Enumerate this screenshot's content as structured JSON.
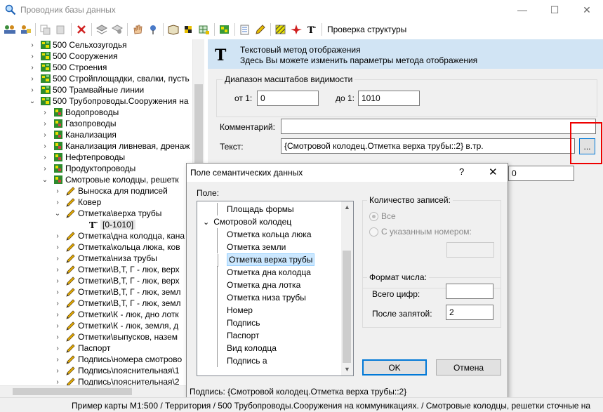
{
  "window": {
    "title": "Проводник базы данных",
    "minimize": "—",
    "maximize": "☐",
    "close": "✕"
  },
  "toolbar": {
    "check_structure": "Проверка структуры"
  },
  "tree": {
    "items": [
      {
        "label": "500 Сельхозугодья",
        "level": 0,
        "chev": "›",
        "icon": "map-layer-icon"
      },
      {
        "label": "500 Сооружения",
        "level": 0,
        "chev": "›",
        "icon": "map-layer-icon"
      },
      {
        "label": "500 Строения",
        "level": 0,
        "chev": "›",
        "icon": "map-layer-icon"
      },
      {
        "label": "500 Стройплощадки, свалки, пусть",
        "level": 0,
        "chev": "›",
        "icon": "map-layer-icon"
      },
      {
        "label": "500 Трамвайные линии",
        "level": 0,
        "chev": "›",
        "icon": "map-layer-icon"
      },
      {
        "label": "500 Трубопроводы.Сооружения на",
        "level": 0,
        "chev": "⌄",
        "icon": "map-layer-icon"
      },
      {
        "label": "Водопроводы",
        "level": 1,
        "chev": "›",
        "icon": "object-icon"
      },
      {
        "label": "Газопроводы",
        "level": 1,
        "chev": "›",
        "icon": "object-icon"
      },
      {
        "label": "Канализация",
        "level": 1,
        "chev": "›",
        "icon": "object-icon"
      },
      {
        "label": "Канализация ливневая, дренаж",
        "level": 1,
        "chev": "›",
        "icon": "object-icon"
      },
      {
        "label": "Нефтепроводы",
        "level": 1,
        "chev": "›",
        "icon": "object-icon"
      },
      {
        "label": "Продуктопроводы",
        "level": 1,
        "chev": "›",
        "icon": "object-icon"
      },
      {
        "label": "Смотровые колодцы, решетк",
        "level": 1,
        "chev": "⌄",
        "icon": "object-icon"
      },
      {
        "label": "Выноска для подписей",
        "level": 2,
        "chev": "›",
        "icon": "pencil-icon"
      },
      {
        "label": "Ковер",
        "level": 2,
        "chev": "›",
        "icon": "pencil-icon"
      },
      {
        "label": "Отметка\\верха трубы",
        "level": 2,
        "chev": "⌄",
        "icon": "pencil-icon"
      },
      {
        "label": "[0-1010]",
        "level": 3,
        "chev": "",
        "icon": "text-method-icon"
      },
      {
        "label": "Отметка\\дна колодца, кана",
        "level": 2,
        "chev": "›",
        "icon": "pencil-icon"
      },
      {
        "label": "Отметка\\кольца люка, ков",
        "level": 2,
        "chev": "›",
        "icon": "pencil-icon"
      },
      {
        "label": "Отметка\\низа трубы",
        "level": 2,
        "chev": "›",
        "icon": "pencil-icon"
      },
      {
        "label": "Отметки\\В,Т, Г - люк, верх",
        "level": 2,
        "chev": "›",
        "icon": "pencil-icon"
      },
      {
        "label": "Отметки\\В,Т, Г - люк, верх",
        "level": 2,
        "chev": "›",
        "icon": "pencil-icon"
      },
      {
        "label": "Отметки\\В,Т, Г - люк, земл",
        "level": 2,
        "chev": "›",
        "icon": "pencil-icon"
      },
      {
        "label": "Отметки\\В,Т, Г - люк, земл",
        "level": 2,
        "chev": "›",
        "icon": "pencil-icon"
      },
      {
        "label": "Отметки\\К - люк, дно лотк",
        "level": 2,
        "chev": "›",
        "icon": "pencil-icon"
      },
      {
        "label": "Отметки\\К - люк, земля, д",
        "level": 2,
        "chev": "›",
        "icon": "pencil-icon"
      },
      {
        "label": "Отметки\\выпусков, назем",
        "level": 2,
        "chev": "›",
        "icon": "pencil-icon"
      },
      {
        "label": "Паспорт",
        "level": 2,
        "chev": "›",
        "icon": "pencil-icon"
      },
      {
        "label": "Подпись\\номера смотрово",
        "level": 2,
        "chev": "›",
        "icon": "pencil-icon"
      },
      {
        "label": "Подпись\\пояснительная\\1",
        "level": 2,
        "chev": "›",
        "icon": "pencil-icon"
      },
      {
        "label": "Подпись\\пояснительная\\2",
        "level": 2,
        "chev": "›",
        "icon": "pencil-icon"
      }
    ]
  },
  "panel": {
    "header_title": "Текстовый метод отображения",
    "header_subtitle": "Здесь Вы можете изменить параметры метода отображения",
    "scale_group": "Диапазон масштабов видимости",
    "from_label": "от 1:",
    "from_value": "0",
    "to_label": "до 1:",
    "to_value": "1010",
    "comment_label": "Комментарий:",
    "comment_value": "",
    "text_label": "Текст:",
    "text_value": "{Смотровой колодец.Отметка верха трубы::2} в.тр.",
    "browse_label": "...",
    "partial_value": "0"
  },
  "dialog": {
    "title": "Поле семантических данных",
    "help": "?",
    "close": "✕",
    "field_label": "Поле:",
    "list_items": [
      {
        "label": "Площадь формы",
        "indent": 1,
        "toggle": ""
      },
      {
        "label": "Смотровой колодец",
        "indent": 0,
        "toggle": "⌄"
      },
      {
        "label": "Отметка кольца люка",
        "indent": 1,
        "toggle": ""
      },
      {
        "label": "Отметка земли",
        "indent": 1,
        "toggle": ""
      },
      {
        "label": "Отметка верха трубы",
        "indent": 1,
        "toggle": "",
        "selected": true
      },
      {
        "label": "Отметка дна колодца",
        "indent": 1,
        "toggle": ""
      },
      {
        "label": "Отметка дна лотка",
        "indent": 1,
        "toggle": ""
      },
      {
        "label": "Отметка низа трубы",
        "indent": 1,
        "toggle": ""
      },
      {
        "label": "Номер",
        "indent": 1,
        "toggle": ""
      },
      {
        "label": "Подпись",
        "indent": 1,
        "toggle": ""
      },
      {
        "label": "Паспорт",
        "indent": 1,
        "toggle": ""
      },
      {
        "label": "Вид колодца",
        "indent": 1,
        "toggle": ""
      },
      {
        "label": "Подпись а",
        "indent": 1,
        "toggle": ""
      }
    ],
    "records_group": "Количество записей:",
    "radio_all": "Все",
    "radio_number": "С указанным номером:",
    "number_format_group": "Формат числа:",
    "total_digits_label": "Всего цифр:",
    "total_digits_value": "",
    "after_point_label": "После запятой:",
    "after_point_value": "2",
    "ok": "OK",
    "cancel": "Отмена",
    "status": "Подпись: {Смотровой колодец.Отметка верха трубы::2}"
  },
  "statusbar": {
    "path": "Пример карты М1:500 / Территория / 500 Трубопроводы.Сооружения на коммуникациях. / Смотровые колодцы, решетки сточные на"
  }
}
